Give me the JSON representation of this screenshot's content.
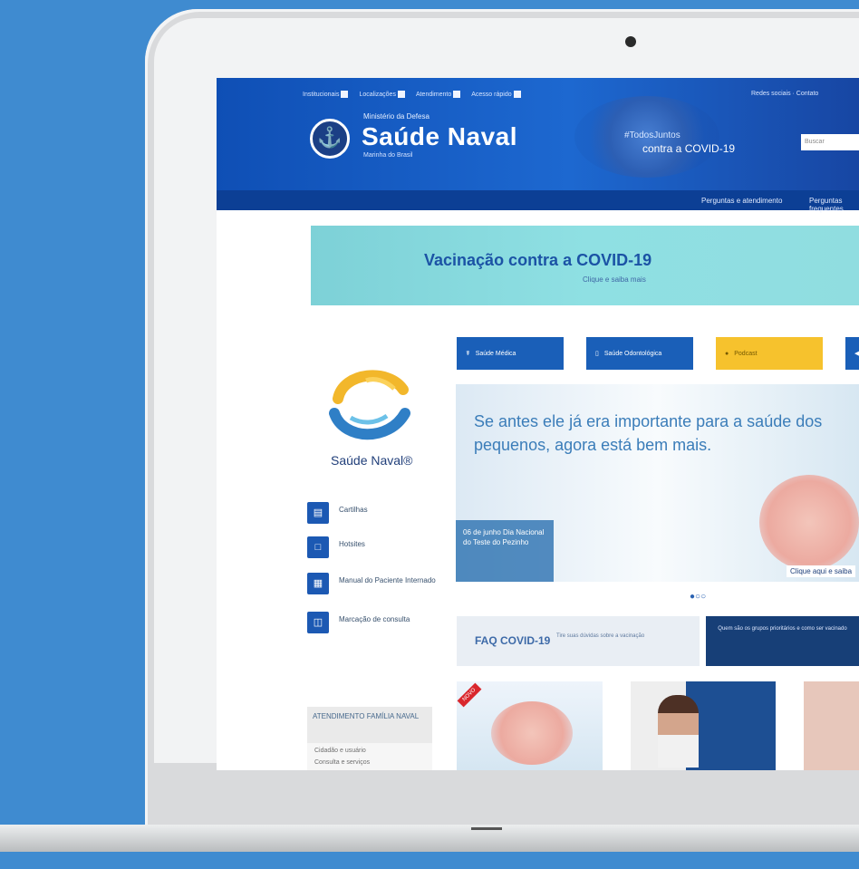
{
  "header": {
    "utility_links": [
      "Institucionais",
      "Localizações",
      "Atendimento",
      "Acesso rápido"
    ],
    "right_links": "Redes sociais · Contato",
    "government_label": "Ministério da Defesa",
    "site_title": "Saúde Naval",
    "site_subtitle": "Marinha do Brasil",
    "campaign_line_1": "#TodosJuntos",
    "campaign_line_2": "contra a COVID-19",
    "search_placeholder": "Buscar"
  },
  "navigation": [
    "Perguntas e atendimento",
    "Perguntas frequentes"
  ],
  "banner": {
    "title": "Vacinação contra a COVID-19",
    "subtitle": "Clique e saiba mais"
  },
  "sidebar": {
    "brand_name": "Saúde Naval®",
    "items": [
      {
        "label": "Cartilhas",
        "icon": "booklet-icon"
      },
      {
        "label": "Hotsites",
        "icon": "window-icon"
      },
      {
        "label": "Manual do Paciente Internado",
        "icon": "manual-icon"
      },
      {
        "label": "Marcação de consulta",
        "icon": "calendar-icon"
      }
    ],
    "panel_title": "ATENDIMENTO FAMÍLIA NAVAL",
    "panel_items": [
      "Cidadão e usuário",
      "Consulta e serviços"
    ]
  },
  "quick_actions": [
    {
      "label": "Saúde Médica",
      "icon": "stethoscope-icon",
      "color": "#1a5fb8"
    },
    {
      "label": "Saúde Odontológica",
      "icon": "tooth-icon",
      "color": "#1a5fb8"
    },
    {
      "label": "Podcast",
      "icon": "microphone-icon",
      "color": "#f6c22d"
    },
    {
      "label": "",
      "icon": "arrow-icon",
      "color": "#1a5fb8"
    }
  ],
  "hero": {
    "message": "Se antes ele já era importante para a saúde dos pequenos, agora está bem mais.",
    "event": "06 de junho\nDia Nacional do\nTeste do Pezinho",
    "cta": "Clique aqui e saiba",
    "dots": "●○○"
  },
  "faq_card": {
    "title": "FAQ COVID-19",
    "subtitle": "Tire suas dúvidas sobre a vacinação"
  },
  "info_card": "Quem são os grupos prioritários e como ser vacinado",
  "news_labels": [
    "NOVO"
  ]
}
